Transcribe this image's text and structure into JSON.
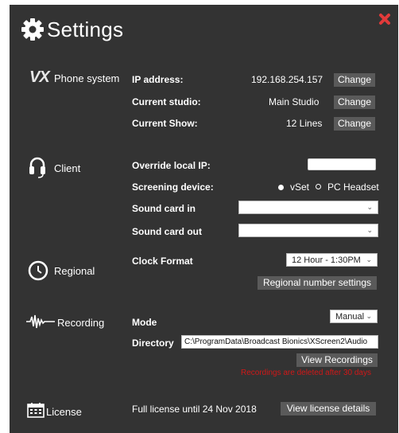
{
  "header": {
    "title": "Settings"
  },
  "phone_system": {
    "logo_text": "VX",
    "label": "Phone system",
    "ip_label": "IP address:",
    "ip_value": "192.168.254.157",
    "studio_label": "Current studio:",
    "studio_value": "Main Studio",
    "show_label": "Current Show:",
    "show_value": "12 Lines",
    "change_label": "Change"
  },
  "client": {
    "label": "Client",
    "override_label": "Override local IP:",
    "override_value": "",
    "screening_label": "Screening device:",
    "option_vset": "vSet",
    "option_pc": "PC Headset",
    "sound_in_label": "Sound card in",
    "sound_in_value": "",
    "sound_out_label": "Sound card out",
    "sound_out_value": ""
  },
  "regional": {
    "label": "Regional",
    "clock_label": "Clock Format",
    "clock_value": "12 Hour - 1:30PM",
    "number_settings_label": "Regional number settings"
  },
  "recording": {
    "label": "Recording",
    "mode_label": "Mode",
    "mode_value": "Manual",
    "directory_label": "Directory",
    "directory_value": "C:\\ProgramData\\Broadcast Bionics\\XScreen2\\Audio",
    "view_recordings_label": "View Recordings",
    "warning": "Recordings are deleted after 30 days"
  },
  "license": {
    "label": "License",
    "status": "Full license until 24 Nov 2018",
    "details_label": "View license details"
  },
  "colors": {
    "background": "#333333",
    "button": "#5a5a5a",
    "close": "#e23a3a",
    "warning": "#d01818"
  }
}
